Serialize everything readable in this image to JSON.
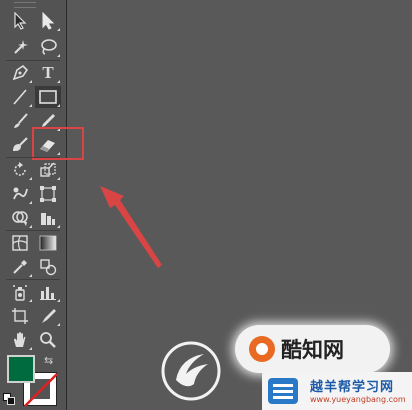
{
  "toolbar": {
    "type_tool_glyph": "T",
    "tools": [
      {
        "name": "selection-tool",
        "icon": "arrow-black-icon"
      },
      {
        "name": "direct-selection-tool",
        "icon": "arrow-white-icon"
      },
      {
        "name": "magic-wand-tool",
        "icon": "magic-wand-icon"
      },
      {
        "name": "lasso-tool",
        "icon": "lasso-icon"
      },
      {
        "name": "pen-tool",
        "icon": "pen-icon"
      },
      {
        "name": "type-tool",
        "icon": "type-icon"
      },
      {
        "name": "line-segment-tool",
        "icon": "line-icon"
      },
      {
        "name": "rectangle-tool",
        "icon": "rectangle-icon"
      },
      {
        "name": "paintbrush-tool",
        "icon": "paintbrush-icon"
      },
      {
        "name": "pencil-tool",
        "icon": "pencil-icon"
      },
      {
        "name": "blob-brush-tool",
        "icon": "blob-brush-icon"
      },
      {
        "name": "eraser-tool",
        "icon": "eraser-icon"
      },
      {
        "name": "rotate-tool",
        "icon": "rotate-icon"
      },
      {
        "name": "scale-tool",
        "icon": "scale-icon"
      },
      {
        "name": "warp-tool",
        "icon": "warp-icon"
      },
      {
        "name": "free-transform-tool",
        "icon": "free-transform-icon"
      },
      {
        "name": "shape-builder-tool",
        "icon": "shape-builder-icon"
      },
      {
        "name": "perspective-grid-tool",
        "icon": "perspective-grid-icon"
      },
      {
        "name": "mesh-tool",
        "icon": "mesh-icon"
      },
      {
        "name": "gradient-tool",
        "icon": "gradient-icon"
      },
      {
        "name": "eyedropper-tool",
        "icon": "eyedropper-icon"
      },
      {
        "name": "blend-tool",
        "icon": "blend-icon"
      },
      {
        "name": "symbol-sprayer-tool",
        "icon": "symbol-sprayer-icon"
      },
      {
        "name": "column-graph-tool",
        "icon": "column-graph-icon"
      },
      {
        "name": "artboard-tool",
        "icon": "artboard-icon"
      },
      {
        "name": "slice-tool",
        "icon": "slice-icon"
      },
      {
        "name": "hand-tool",
        "icon": "hand-icon"
      },
      {
        "name": "zoom-tool",
        "icon": "zoom-icon"
      }
    ],
    "selected_tool": "eraser-tool",
    "fill_color": "#006b3f",
    "stroke_color": "none"
  },
  "annotation": {
    "highlight_color": "#d94545",
    "arrow_color": "#d94545"
  },
  "watermarks": {
    "badge_text": "酷知网",
    "site_name": "越羊帮学习网",
    "site_url": "www.yueyangbang.com"
  }
}
